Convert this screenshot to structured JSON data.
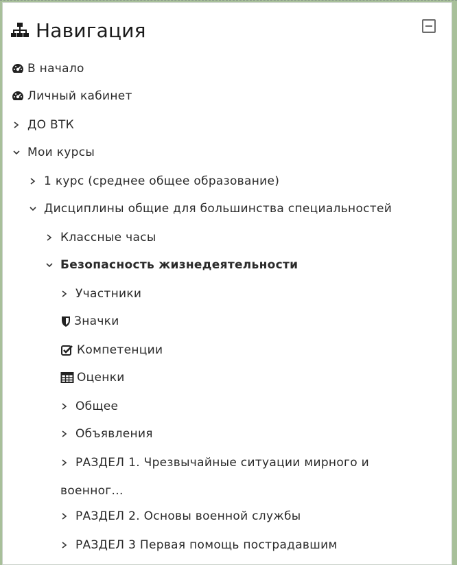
{
  "block": {
    "title": "Навигация",
    "collapse_icon": "minus-square-icon"
  },
  "nav": {
    "home": {
      "label": "В начало",
      "icon": "dashboard-icon"
    },
    "dashboard": {
      "label": "Личный кабинет",
      "icon": "dashboard-icon"
    },
    "do_vtk": {
      "label": "ДО ВТК"
    },
    "my_courses": {
      "label": "Мои курсы"
    },
    "course_1": {
      "label": "1 курс (среднее общее образование)"
    },
    "disciplines": {
      "label": "Дисциплины общие для большинства специальностей"
    },
    "class_hours": {
      "label": "Классные часы"
    },
    "bzh": {
      "label": "Безопасность жизнедеятельности"
    },
    "participants": {
      "label": "Участники"
    },
    "badges": {
      "label": "Значки",
      "icon": "shield-icon"
    },
    "competencies": {
      "label": "Компетенции",
      "icon": "check-square-icon"
    },
    "grades": {
      "label": "Оценки",
      "icon": "table-icon"
    },
    "general": {
      "label": "Общее"
    },
    "announcements": {
      "label": "Объявления"
    },
    "section1": {
      "label_line1": "РАЗДЕЛ 1. Чрезвычайные ситуации мирного и",
      "label_line2": "военног..."
    },
    "section2": {
      "label": "РАЗДЕЛ 2. Основы военной службы"
    },
    "section3": {
      "label": "РАЗДЕЛ 3 Первая помощь пострадавшим"
    }
  },
  "colors": {
    "background": "#a8c09a",
    "panel": "#ffffff",
    "text": "#2a2a2a"
  }
}
